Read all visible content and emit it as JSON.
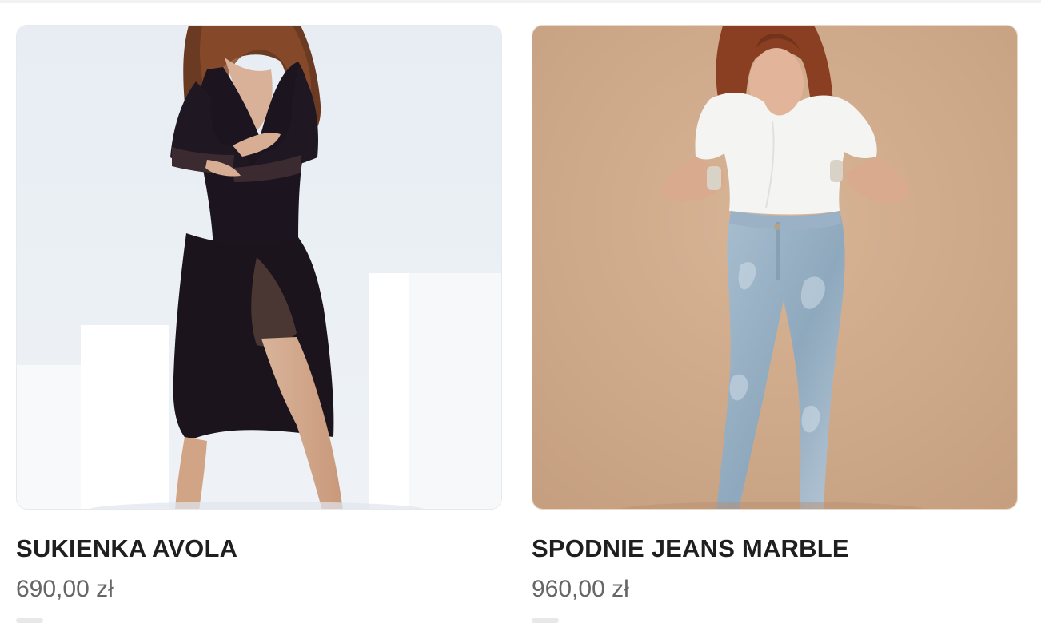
{
  "products": [
    {
      "title": "SUKIENKA AVOLA",
      "price": "690,00 zł",
      "image_alt": "model-wearing-black-wrap-dress"
    },
    {
      "title": "SPODNIE JEANS MARBLE",
      "price": "960,00 zł",
      "image_alt": "model-wearing-white-tee-and-marble-jeans"
    }
  ],
  "colors": {
    "title": "#1f1f1f",
    "price": "#666666",
    "card1_bg": "#e9eef3",
    "card2_bg": "#c8a686"
  }
}
